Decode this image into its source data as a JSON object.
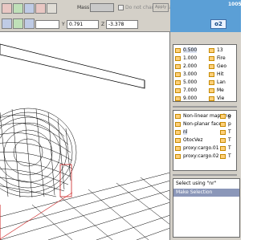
{
  "toolbar": {
    "mass_label": "Mass",
    "mass_value": "",
    "do_not_change_label": "Do not change total m",
    "apply_label": "Apply",
    "y_label": "Y",
    "y_value": "0.791",
    "z_label": "Z",
    "z_value": "-3.378",
    "x_value": "",
    "tool_icons": [
      "select-icon",
      "move-icon",
      "rotate-icon",
      "scale-icon",
      "lock-icon",
      "undo-icon",
      "camera-icon"
    ]
  },
  "header": {
    "title": "1005"
  },
  "lods": {
    "items": [
      {
        "value": "0.500",
        "selected": true
      },
      {
        "value": "1.000"
      },
      {
        "value": "2.000"
      },
      {
        "value": "3.000"
      },
      {
        "value": "5.000"
      },
      {
        "value": "7.000"
      },
      {
        "value": "9.000"
      }
    ],
    "right_items": [
      "13",
      "Fire",
      "Geo",
      "Hit",
      "Lan",
      "Me",
      "Vie"
    ]
  },
  "selections": {
    "items": [
      "Non-linear mapping",
      "Non-planar faces",
      "nl",
      "OtocVez",
      "proxy:cargo.01",
      "proxy:cargo.02"
    ],
    "right_items": [
      "p",
      "p",
      "T",
      "T",
      "T",
      "T"
    ]
  },
  "select_using_label": "Select using \"nr\"",
  "make_selection_label": "Make Selection",
  "colors": {
    "header_blue": "#5b9fd6",
    "panel_gray": "#d4d0c8",
    "wire": "#000000",
    "wire_red": "#cc2222"
  }
}
